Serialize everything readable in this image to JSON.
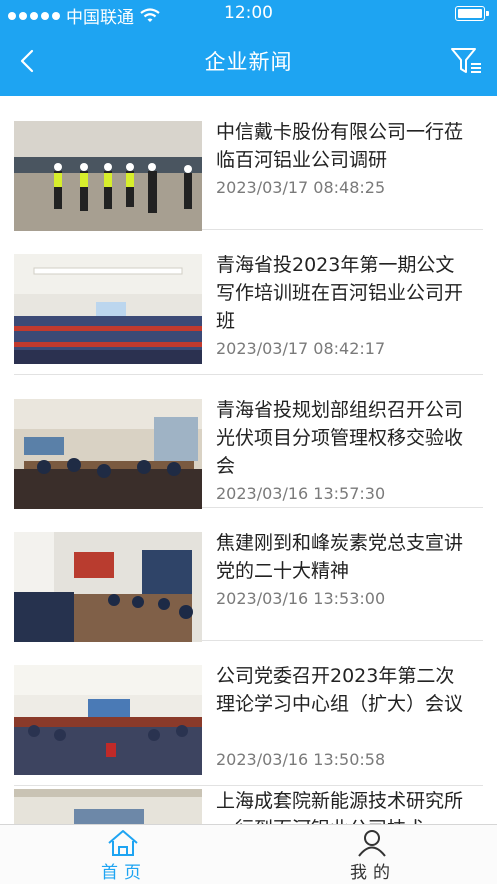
{
  "status": {
    "carrier": "中国联通",
    "time": "12:00"
  },
  "nav": {
    "title": "企业新闻"
  },
  "news": [
    {
      "title": "中信戴卡股份有限公司一行莅临百河铝业公司调研",
      "date": "2023/03/17 08:48:25"
    },
    {
      "title": "青海省投2023年第一期公文写作培训班在百河铝业公司开班",
      "date": "2023/03/17 08:42:17"
    },
    {
      "title": "青海省投规划部组织召开公司光伏项目分项管理权移交验收会",
      "date": "2023/03/16 13:57:30"
    },
    {
      "title": "焦建刚到和峰炭素党总支宣讲党的二十大精神",
      "date": "2023/03/16 13:53:00"
    },
    {
      "title": "公司党委召开2023年第二次理论学习中心组（扩大）会议",
      "date": "2023/03/16 13:50:58"
    },
    {
      "title": "上海成套院新能源技术研究所一行到百河铝业公司技术",
      "date": ""
    }
  ],
  "tabs": {
    "home": "首页",
    "mine": "我的"
  },
  "colors": {
    "primary": "#1ea4f2",
    "tab_active": "#1ea4f2",
    "tab_inactive": "#333333"
  }
}
